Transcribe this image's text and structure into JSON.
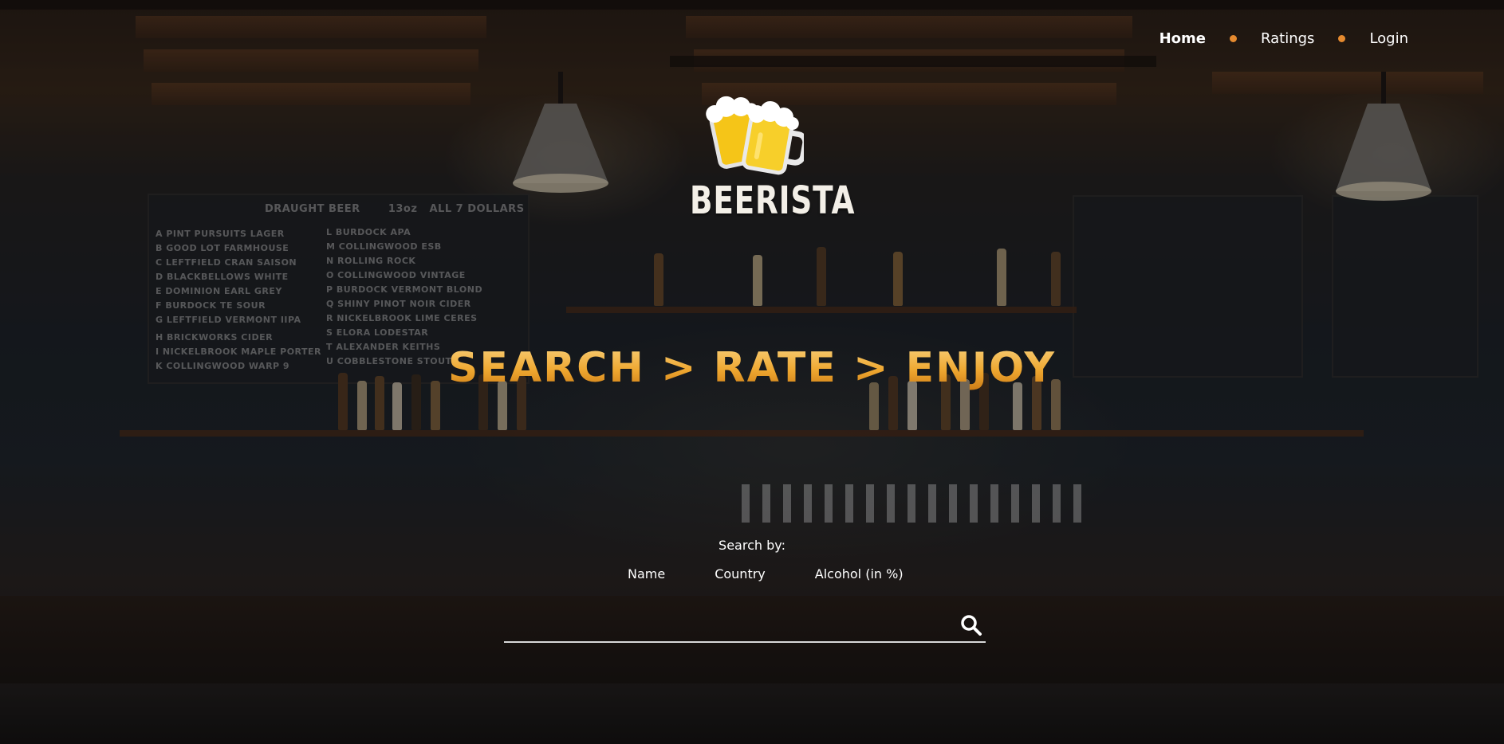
{
  "nav": {
    "items": [
      {
        "label": "Home",
        "active": true
      },
      {
        "label": "Ratings",
        "active": false
      },
      {
        "label": "Login",
        "active": false
      }
    ],
    "separator_color": "#e58a2f"
  },
  "brand": {
    "name": "BEERISTA",
    "logo_icon": "beer-mugs-icon"
  },
  "hero": {
    "tagline": "SEARCH > RATE > ENJOY",
    "tagline_colors": [
      "#f9d07a",
      "#eea730",
      "#c97814"
    ]
  },
  "search": {
    "label": "Search by:",
    "options": [
      "Name",
      "Country",
      "Alcohol (in %)"
    ],
    "value": "",
    "button_icon": "search-icon"
  },
  "background": {
    "description_icon": "bar-interior-photo"
  }
}
